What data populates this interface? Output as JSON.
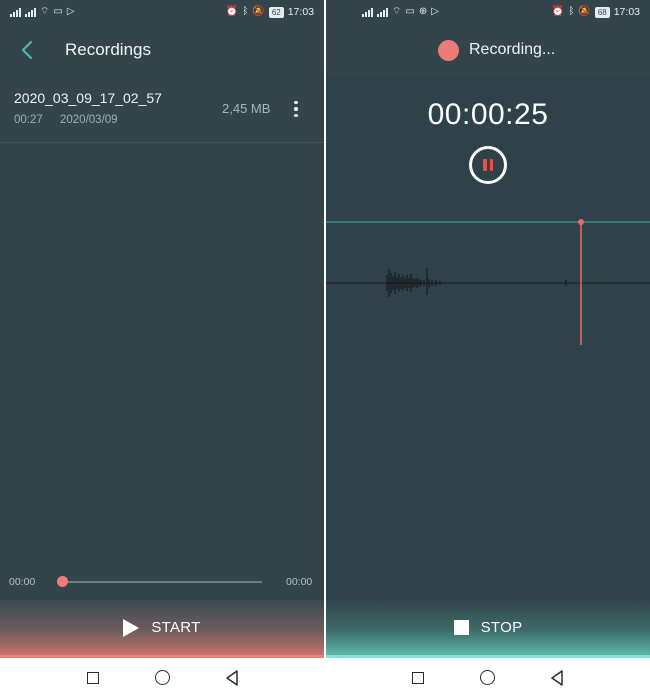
{
  "status_bar": {
    "left": {
      "time": "17:03",
      "battery": "62"
    },
    "right": {
      "time": "17:03",
      "battery": "68"
    }
  },
  "recordings_screen": {
    "title": "Recordings",
    "item": {
      "name": "2020_03_09_17_02_57",
      "duration": "00:27",
      "date": "2020/03/09",
      "size": "2,45 MB"
    },
    "player": {
      "time_start": "00:00",
      "time_end": "00:00",
      "progress": 0
    },
    "start_label": "START"
  },
  "recording_screen": {
    "status": "Recording...",
    "timer": "00:00:25",
    "stop_label": "STOP"
  },
  "icons": {
    "back": "chevron-left-icon",
    "more": "more-vert-icon",
    "play": "play-icon",
    "stop": "stop-icon",
    "pause": "pause-icon",
    "record": "record-dot-icon"
  },
  "colors": {
    "background": "#33444b",
    "accent_red": "#eb7b76",
    "accent_teal": "#4fb8ad",
    "pause_red": "#e8504b"
  }
}
